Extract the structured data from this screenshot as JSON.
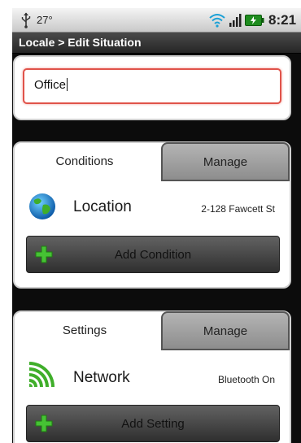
{
  "status_bar": {
    "temperature": "27°",
    "time": "8:21",
    "icons": [
      "usb-icon",
      "wifi-icon",
      "signal-icon",
      "battery-icon"
    ]
  },
  "title_bar": {
    "title": "Locale > Edit Situation"
  },
  "situation": {
    "name_value": "Office"
  },
  "conditions": {
    "tab_label": "Conditions",
    "manage_label": "Manage",
    "items": [
      {
        "icon": "globe-icon",
        "label": "Location",
        "value": "2-128 Fawcett St"
      }
    ],
    "add_label": "Add Condition"
  },
  "settings": {
    "tab_label": "Settings",
    "manage_label": "Manage",
    "items": [
      {
        "icon": "network-icon",
        "label": "Network",
        "value": "Bluetooth On"
      }
    ],
    "add_label": "Add Setting"
  },
  "colors": {
    "input_focus_border": "#e0534a",
    "plus_green": "#46c234",
    "tab_inactive": "#9c9c9c"
  }
}
